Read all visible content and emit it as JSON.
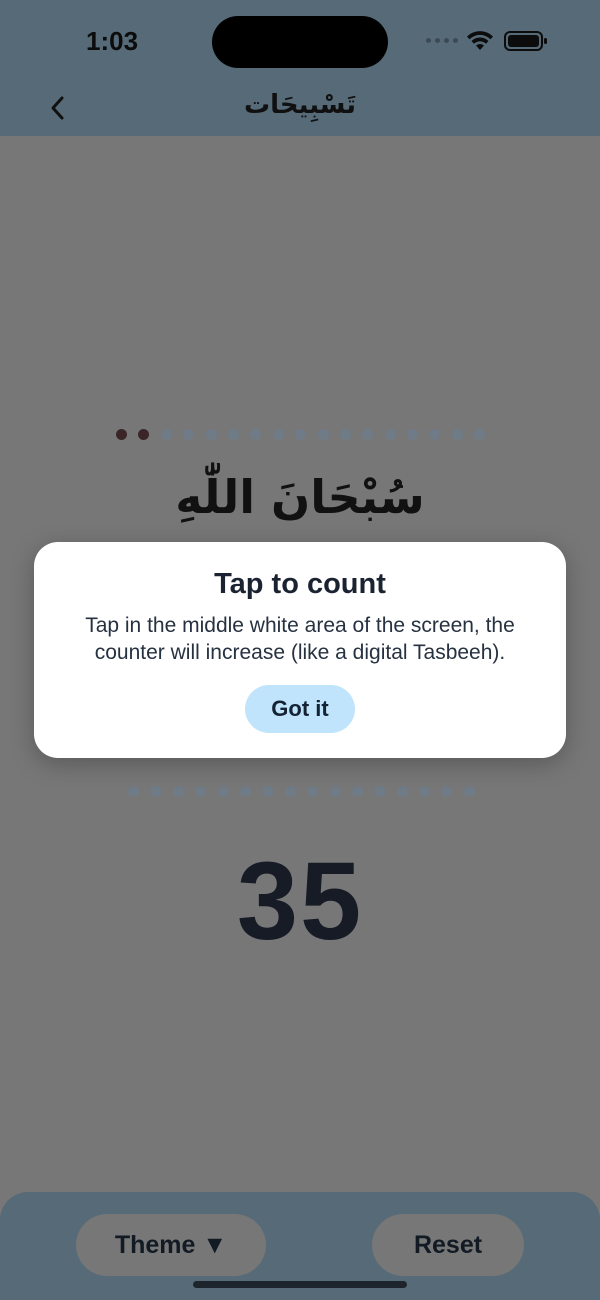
{
  "status_bar": {
    "time": "1:03"
  },
  "nav": {
    "title": "تَسْبِيحَات",
    "back_icon": "chevron-left-icon"
  },
  "progress": {
    "total": 17,
    "completed": 2
  },
  "phrase": "سُبْحَانَ اللّٰهِ",
  "lower_dots": {
    "total": 16
  },
  "counter": "35",
  "modal": {
    "title": "Tap to count",
    "message": "Tap in the middle white area of the screen, the counter will increase (like a digital Tasbeeh).",
    "button": "Got it"
  },
  "bottom_bar": {
    "theme_label": "Theme ▼",
    "reset_label": "Reset"
  },
  "colors": {
    "accent": "#566a77",
    "overlay": "#777777",
    "button_light": "#bfe4fb",
    "text_dark": "#161b26"
  }
}
